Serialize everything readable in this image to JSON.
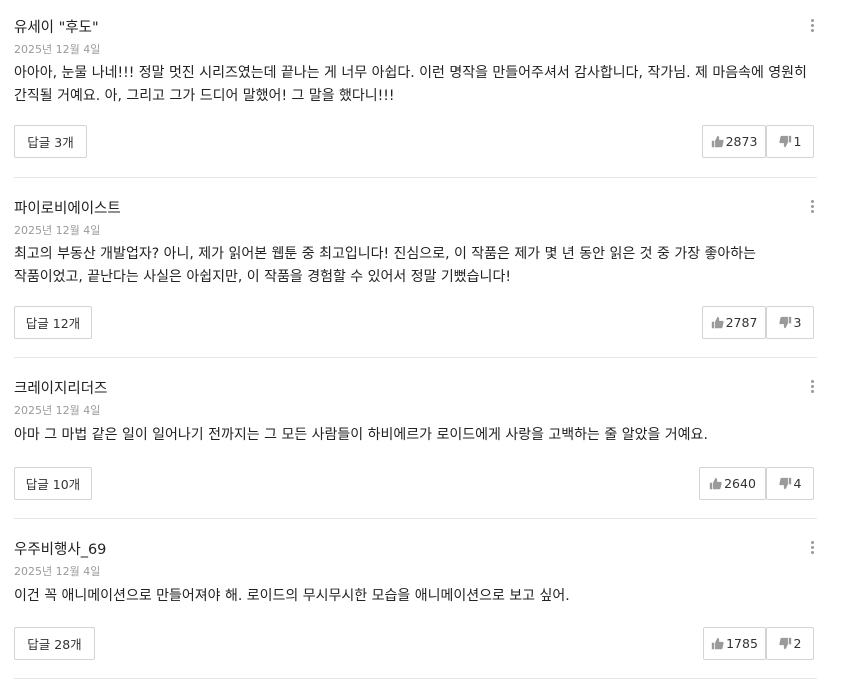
{
  "comments": [
    {
      "author": "유세이 \"후도\"",
      "date": "2025년 12월 4일",
      "text": "아아아, 눈물 나네!!! 정말 멋진 시리즈였는데 끝나는 게 너무 아쉽다. 이런 명작을 만들어주셔서 감사합니다, 작가님. 제 마음속에 영원히 간직될 거예요. 아, 그리고 그가 드디어 말했어! 그 말을 했다니!!!",
      "replies": "답글 3개",
      "likes": "2873",
      "dislikes": "1"
    },
    {
      "author": "파이로비에이스트",
      "date": "2025년 12월 4일",
      "text": "최고의 부동산 개발업자? 아니, 제가 읽어본 웹툰 중 최고입니다! 진심으로, 이 작품은 제가 몇 년 동안 읽은 것 중 가장 좋아하는 작품이었고, 끝난다는 사실은 아쉽지만, 이 작품을 경험할 수 있어서 정말 기뻤습니다!",
      "replies": "답글 12개",
      "likes": "2787",
      "dislikes": "3"
    },
    {
      "author": "크레이지리더즈",
      "date": "2025년 12월 4일",
      "text": "아마 그 마법 같은 일이 일어나기 전까지는 그 모든 사람들이 하비에르가 로이드에게 사랑을 고백하는 줄 알았을 거예요.",
      "replies": "답글 10개",
      "likes": "2640",
      "dislikes": "4"
    },
    {
      "author": "우주비행사_69",
      "date": "2025년 12월 4일",
      "text": "이건 꼭 애니메이션으로 만들어져야 해. 로이드의 무시무시한 모습을 애니메이션으로 보고 싶어.",
      "replies": "답글 28개",
      "likes": "1785",
      "dislikes": "2"
    }
  ],
  "icons": {
    "more": "more-vertical-icon",
    "like": "thumbs-up-icon",
    "dislike": "thumbs-down-icon"
  },
  "colors": {
    "icon": "#9a9a9a",
    "border": "#d4d4d4",
    "divider": "#e6e6e6",
    "meta": "#9a9a9a"
  }
}
